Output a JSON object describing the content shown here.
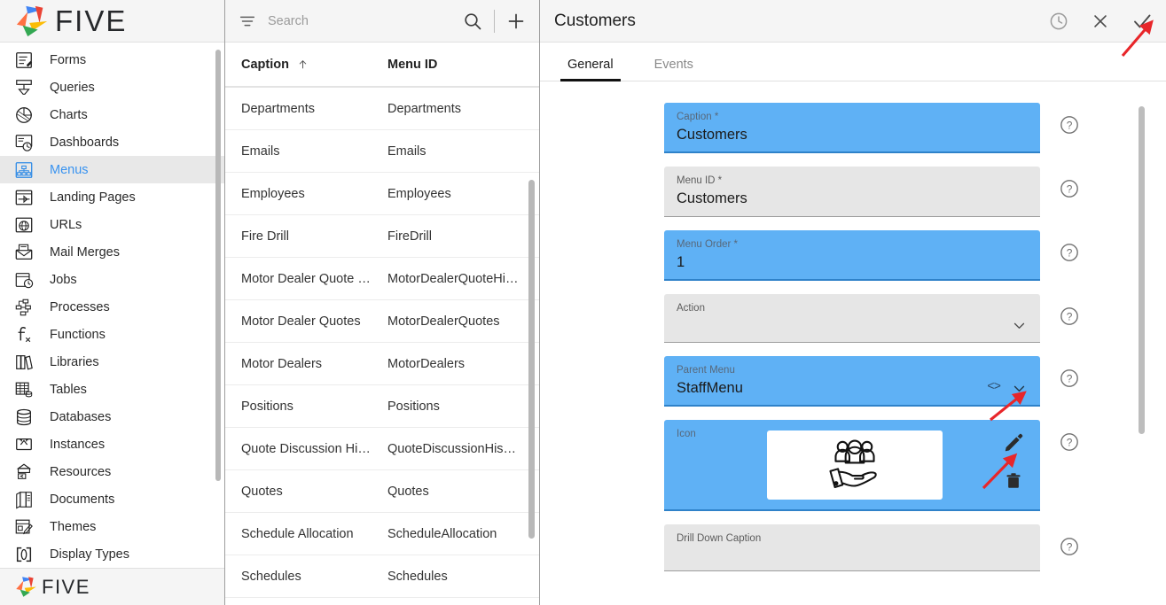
{
  "brand": {
    "name": "FIVE",
    "colors": [
      "#4285f4",
      "#ea4335",
      "#fbbc05",
      "#34a853",
      "#ff7043"
    ]
  },
  "sidebar": {
    "items": [
      {
        "label": "Forms",
        "icon": "forms-icon"
      },
      {
        "label": "Queries",
        "icon": "queries-icon"
      },
      {
        "label": "Charts",
        "icon": "charts-icon"
      },
      {
        "label": "Dashboards",
        "icon": "dashboards-icon"
      },
      {
        "label": "Menus",
        "icon": "menus-icon",
        "active": true
      },
      {
        "label": "Landing Pages",
        "icon": "landing-pages-icon"
      },
      {
        "label": "URLs",
        "icon": "urls-icon"
      },
      {
        "label": "Mail Merges",
        "icon": "mail-merges-icon"
      },
      {
        "label": "Jobs",
        "icon": "jobs-icon"
      },
      {
        "label": "Processes",
        "icon": "processes-icon"
      },
      {
        "label": "Functions",
        "icon": "functions-icon"
      },
      {
        "label": "Libraries",
        "icon": "libraries-icon"
      },
      {
        "label": "Tables",
        "icon": "tables-icon"
      },
      {
        "label": "Databases",
        "icon": "databases-icon"
      },
      {
        "label": "Instances",
        "icon": "instances-icon"
      },
      {
        "label": "Resources",
        "icon": "resources-icon"
      },
      {
        "label": "Documents",
        "icon": "documents-icon"
      },
      {
        "label": "Themes",
        "icon": "themes-icon"
      },
      {
        "label": "Display Types",
        "icon": "display-types-icon"
      }
    ],
    "footer_label": "FIVE"
  },
  "list_panel": {
    "search": {
      "placeholder": "Search",
      "value": ""
    },
    "filter_icon": "filter-icon",
    "search_icon": "search-icon",
    "add_icon": "plus-icon",
    "columns": [
      {
        "label": "Caption",
        "sort": "asc"
      },
      {
        "label": "Menu ID",
        "sort": ""
      }
    ],
    "rows": [
      {
        "caption": "Departments",
        "menu_id": "Departments"
      },
      {
        "caption": "Emails",
        "menu_id": "Emails"
      },
      {
        "caption": "Employees",
        "menu_id": "Employees"
      },
      {
        "caption": "Fire Drill",
        "menu_id": "FireDrill"
      },
      {
        "caption": "Motor Dealer Quote …",
        "menu_id": "MotorDealerQuoteHi…"
      },
      {
        "caption": "Motor Dealer Quotes",
        "menu_id": "MotorDealerQuotes"
      },
      {
        "caption": "Motor Dealers",
        "menu_id": "MotorDealers"
      },
      {
        "caption": "Positions",
        "menu_id": "Positions"
      },
      {
        "caption": "Quote Discussion Hi…",
        "menu_id": "QuoteDiscussionHis…"
      },
      {
        "caption": "Quotes",
        "menu_id": "Quotes"
      },
      {
        "caption": "Schedule Allocation",
        "menu_id": "ScheduleAllocation"
      },
      {
        "caption": "Schedules",
        "menu_id": "Schedules"
      }
    ]
  },
  "detail": {
    "title": "Customers",
    "header_icons": [
      {
        "name": "history-icon"
      },
      {
        "name": "close-icon"
      },
      {
        "name": "confirm-check-icon"
      }
    ],
    "tabs": [
      {
        "label": "General",
        "active": true
      },
      {
        "label": "Events",
        "active": false
      }
    ],
    "fields": {
      "caption": {
        "label": "Caption *",
        "value": "Customers",
        "state": "blue"
      },
      "menu_id": {
        "label": "Menu ID *",
        "value": "Customers",
        "state": "grey"
      },
      "menu_order": {
        "label": "Menu Order *",
        "value": "1",
        "state": "blue"
      },
      "action": {
        "label": "Action",
        "value": "",
        "state": "grey"
      },
      "parent_menu": {
        "label": "Parent Menu",
        "value": "StaffMenu",
        "state": "blue"
      },
      "icon": {
        "label": "Icon",
        "value": "",
        "state": "blue",
        "preview_icon": "people-in-hand-icon"
      },
      "drill_down": {
        "label": "Drill Down Caption",
        "value": "",
        "state": "grey"
      }
    },
    "help_icon": "help-circle-icon",
    "accent_blue": "#5fb1f5",
    "annotation_arrow_color": "#e8262a"
  }
}
